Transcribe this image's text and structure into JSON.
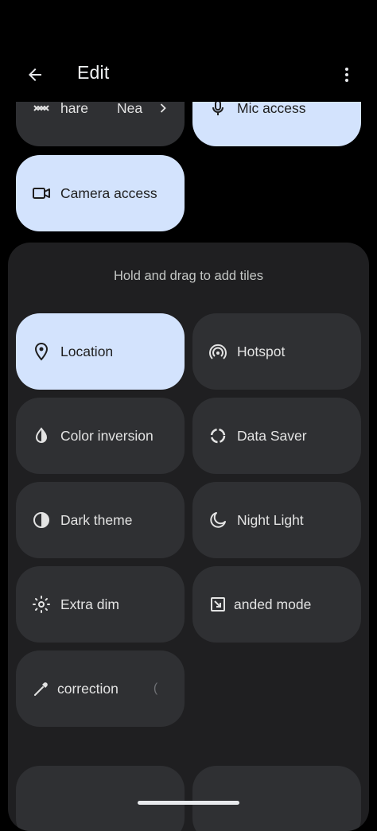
{
  "header": {
    "title": "Edit"
  },
  "current_tiles": [
    {
      "label": "hare",
      "icon": "nearby-share-icon",
      "active": false
    },
    {
      "label": "Nea",
      "icon": "chevron-right-icon",
      "active": false
    },
    {
      "label": "Mic access",
      "icon": "mic-icon",
      "active": true
    },
    {
      "label": "Camera access",
      "icon": "camera-icon",
      "active": true
    }
  ],
  "available": {
    "hint": "Hold and drag to add tiles",
    "tiles": [
      {
        "label": "Location",
        "icon": "location-icon",
        "active": true
      },
      {
        "label": "Hotspot",
        "icon": "hotspot-icon",
        "active": false
      },
      {
        "label": "Color inversion",
        "icon": "color-inversion-icon",
        "active": false
      },
      {
        "label": "Data Saver",
        "icon": "data-saver-icon",
        "active": false
      },
      {
        "label": "Dark theme",
        "icon": "dark-theme-icon",
        "active": false
      },
      {
        "label": "Night Light",
        "icon": "night-light-icon",
        "active": false
      },
      {
        "label": "Extra dim",
        "icon": "extra-dim-icon",
        "active": false
      },
      {
        "label": "anded mode",
        "icon": "one-handed-mode-icon",
        "active": false
      },
      {
        "label": "correction",
        "icon": "color-correction-icon",
        "active": false
      }
    ]
  },
  "colors": {
    "background": "#000000",
    "tile_inactive": "#2f3033",
    "tile_active": "#d3e3fd",
    "panel": "#1f1f21"
  }
}
